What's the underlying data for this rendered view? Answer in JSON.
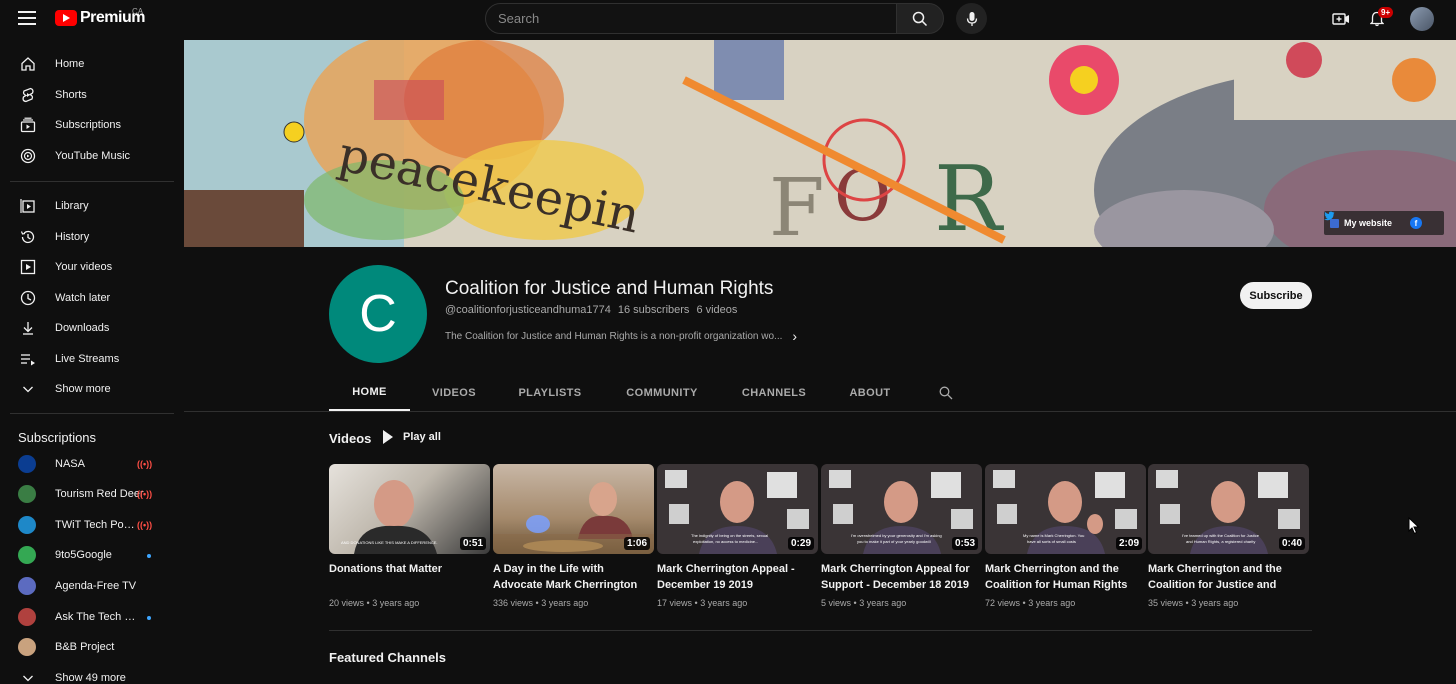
{
  "topbar": {
    "logo_text": "Premium",
    "country": "CA",
    "search_placeholder": "Search",
    "notification_badge": "9+"
  },
  "sidebar": {
    "nav": [
      {
        "label": "Home",
        "icon": "home-icon"
      },
      {
        "label": "Shorts",
        "icon": "shorts-icon"
      },
      {
        "label": "Subscriptions",
        "icon": "subscriptions-icon"
      },
      {
        "label": "YouTube Music",
        "icon": "music-icon"
      }
    ],
    "library": [
      {
        "label": "Library",
        "icon": "library-icon"
      },
      {
        "label": "History",
        "icon": "history-icon"
      },
      {
        "label": "Your videos",
        "icon": "your-videos-icon"
      },
      {
        "label": "Watch later",
        "icon": "clock-icon"
      },
      {
        "label": "Downloads",
        "icon": "download-icon"
      },
      {
        "label": "Live Streams",
        "icon": "live-streams-icon"
      },
      {
        "label": "Show more",
        "icon": "chevron-down-icon"
      }
    ],
    "subscriptions_header": "Subscriptions",
    "subscriptions": [
      {
        "label": "NASA",
        "color": "#0b3d91",
        "status": "live"
      },
      {
        "label": "Tourism Red Deer",
        "color": "#3a7d44",
        "status": "live"
      },
      {
        "label": "TWiT Tech Podcast Network",
        "color": "#1e88c8",
        "status": "live"
      },
      {
        "label": "9to5Google",
        "color": "#34a853",
        "status": "new"
      },
      {
        "label": "Agenda-Free TV",
        "color": "#5c6bc0",
        "status": ""
      },
      {
        "label": "Ask The Tech Guys",
        "color": "#b0413e",
        "status": "new"
      },
      {
        "label": "B&B Project",
        "color": "#c9a27e",
        "status": ""
      }
    ],
    "show_more_subs": "Show 49 more",
    "live_symbol": "((•))"
  },
  "banner": {
    "website_label": "My website",
    "facebook_label": "f"
  },
  "channel": {
    "avatar_letter": "C",
    "name": "Coalition for Justice and Human Rights",
    "handle": "@coalitionforjusticeandhuma1774",
    "subscribers": "16 subscribers",
    "video_count": "6 videos",
    "description": "The Coalition for Justice and Human Rights is a non-profit organization wo...",
    "subscribe_label": "Subscribe"
  },
  "tabs": [
    "HOME",
    "VIDEOS",
    "PLAYLISTS",
    "COMMUNITY",
    "CHANNELS",
    "ABOUT"
  ],
  "videos_section": {
    "title": "Videos",
    "play_all": "Play all",
    "items": [
      {
        "title": "Donations that Matter",
        "duration": "0:51",
        "views": "20 views",
        "age": "3 years ago",
        "caption": "AND DONATIONS LIKE THIS MAKE A DIFFERENCE."
      },
      {
        "title": "A Day in the Life with Advocate Mark Cherrington",
        "duration": "1:06",
        "views": "336 views",
        "age": "3 years ago",
        "caption": ""
      },
      {
        "title": "Mark Cherrington Appeal - December 19 2019",
        "duration": "0:29",
        "views": "17 views",
        "age": "3 years ago",
        "caption": "The indignity of being on the streets, sexual exploitation, no access to medicine..."
      },
      {
        "title": "Mark Cherrington Appeal for Support - December 18 2019",
        "duration": "0:53",
        "views": "5 views",
        "age": "3 years ago",
        "caption": "I'm overwhelmed by your generosity and I'm asking you to make it part of your yearly goodwill"
      },
      {
        "title": "Mark Cherrington and the Coalition for Human Rights",
        "duration": "2:09",
        "views": "72 views",
        "age": "3 years ago",
        "caption": "My name is Mark Cherrington. You have all sorts of small costs"
      },
      {
        "title": "Mark Cherrington and the Coalition for Justice and Human Rights",
        "duration": "0:40",
        "views": "35 views",
        "age": "3 years ago",
        "caption": "I've teamed up with the Coalition for Justice and Human Rights, a registered charity"
      }
    ]
  },
  "featured_title": "Featured Channels",
  "meta_separator": "•"
}
